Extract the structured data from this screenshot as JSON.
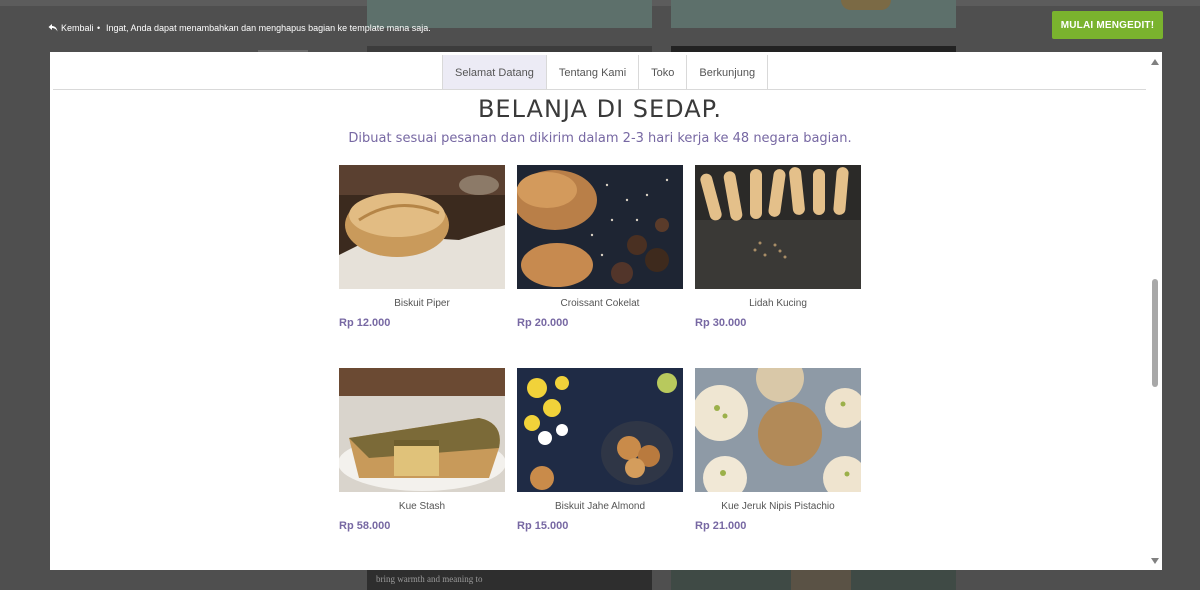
{
  "toolbar": {
    "back_label": "Kembali",
    "separator": "•",
    "tip": "Ingat, Anda dapat menambahkan dan menghapus bagian ke template mana saja.",
    "start_button": "MULAI MENGEDIT!"
  },
  "background": {
    "snippet": "bring warmth and meaning to"
  },
  "modal": {
    "tabs": [
      {
        "label": "Selamat Datang",
        "active": true
      },
      {
        "label": "Tentang Kami",
        "active": false
      },
      {
        "label": "Toko",
        "active": false
      },
      {
        "label": "Berkunjung",
        "active": false
      }
    ],
    "title": "BELANJA DI SEDAP.",
    "subtitle": "Dibuat sesuai pesanan dan dikirim dalam 2-3 hari kerja ke 48 negara bagian.",
    "products": [
      {
        "name": "Biskuit Piper",
        "price": "Rp 12.000"
      },
      {
        "name": "Croissant Cokelat",
        "price": "Rp 20.000"
      },
      {
        "name": "Lidah Kucing",
        "price": "Rp 30.000"
      },
      {
        "name": "Kue Stash",
        "price": "Rp 58.000"
      },
      {
        "name": "Biskuit Jahe Almond",
        "price": "Rp 15.000"
      },
      {
        "name": "Kue Jeruk Nipis Pistachio",
        "price": "Rp 21.000"
      }
    ]
  },
  "colors": {
    "accent": "#7768a3",
    "button_green": "#7ab32e",
    "active_tab_bg": "#ecebf5"
  },
  "icons": {
    "back": "back-arrow-icon",
    "scroll_up": "scroll-up-arrow-icon",
    "scroll_down": "scroll-down-arrow-icon"
  }
}
